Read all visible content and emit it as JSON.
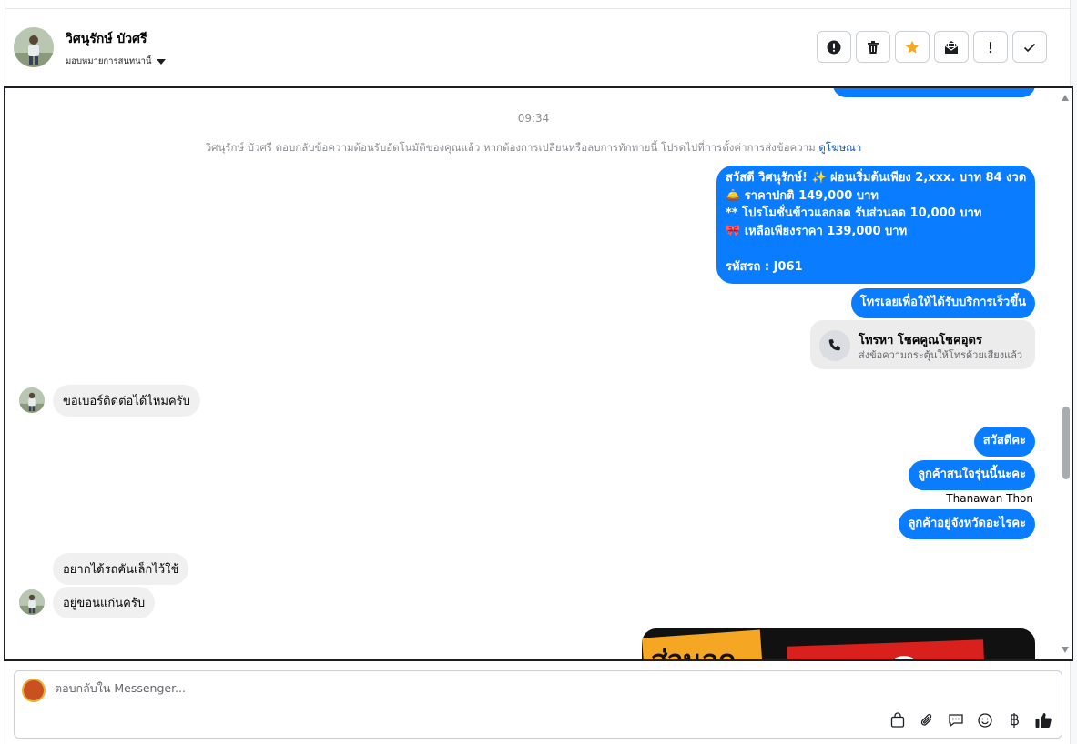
{
  "header": {
    "contact_name": "วิศนุรักษ์ บัวศรี",
    "assign_label": "มอบหมายการสนทนานี้"
  },
  "conversation": {
    "timestamp": "09:34",
    "system_message": "วิศนุรักษ์ บัวศรี ตอบกลับข้อความต้อนรับอัตโนมัติของคุณแล้ว หากต้องการเปลี่ยนหรือลบการทักทายนี้ โปรดไปที่การตั้งค่าการส่งข้อความ",
    "system_link": "ดูโฆษณา",
    "promo_lines": [
      "สวัสดี วิศนุรักษ์! ✨  ผ่อนเริ่มต้นเพียง 2,xxx. บาท 84 งวด",
      "🛎️ ราคาปกติ 149,000 บาท",
      "** โปรโมชั่นข้าวแลกลด รับส่วนลด 10,000 บาท",
      "🎀  เหลือเพียงราคา 139,000 บาท",
      "",
      " รหัสรถ : J061"
    ],
    "call_prompt": "โทรเลยเพื่อให้ได้รับบริการเร็วขึ้น",
    "call_card": {
      "title": "โทรหา โชคคูณโชคอุดร",
      "subtitle": "ส่งข้อความกระตุ้นให้โทรด้วยเสียงแล้ว"
    },
    "in_msg_1": "ขอเบอร์ติดต่อได้ไหมครับ",
    "out_msg_hello": "สวัสดีคะ",
    "out_msg_interest": "ลูกค้าสนใจรุ่นนี้นะคะ",
    "sender_name": "Thanawan Thon",
    "out_msg_province": "ลูกค้าอยู่จังหวัดอะไรคะ",
    "in_msg_2": "อยากได้รถคันเล็กไว้ใช้",
    "in_msg_3": "อยู่ขอนแก่นครับ",
    "media_text": "ส่วนลด"
  },
  "composer": {
    "placeholder": "ตอบกลับใน Messenger..."
  },
  "colors": {
    "accent": "#0a7cff",
    "star": "#f5a623"
  }
}
